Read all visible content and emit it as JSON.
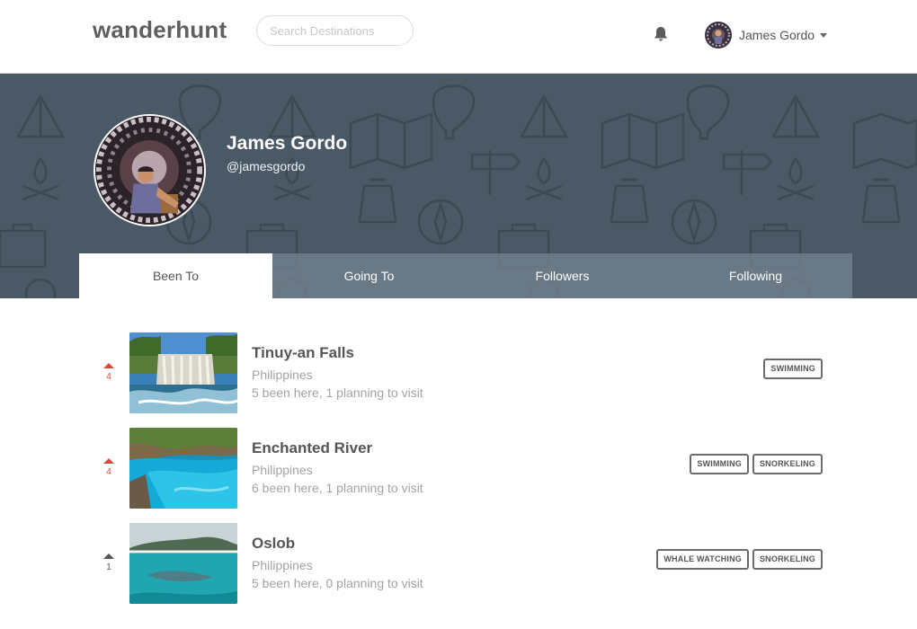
{
  "app": {
    "logo": "wanderhunt"
  },
  "search": {
    "placeholder": "Search Destinations",
    "value": ""
  },
  "header": {
    "notifications_icon": "bell-icon",
    "user_name": "James Gordo"
  },
  "profile": {
    "name": "James Gordo",
    "handle": "@jamesgordo"
  },
  "tabs": [
    {
      "label": "Been To",
      "active": true
    },
    {
      "label": "Going To",
      "active": false
    },
    {
      "label": "Followers",
      "active": false
    },
    {
      "label": "Following",
      "active": false
    }
  ],
  "destinations": [
    {
      "title": "Tinuy-an Falls",
      "country": "Philippines",
      "stats": "5 been here, 1 planning to visit",
      "votes": "4",
      "voted": true,
      "tags": [
        "SWIMMING"
      ]
    },
    {
      "title": "Enchanted River",
      "country": "Philippines",
      "stats": "6 been here, 1 planning to visit",
      "votes": "4",
      "voted": true,
      "tags": [
        "SWIMMING",
        "SNORKELING"
      ]
    },
    {
      "title": "Oslob",
      "country": "Philippines",
      "stats": "5 been here, 0 planning to visit",
      "votes": "1",
      "voted": false,
      "tags": [
        "WHALE WATCHING",
        "SNORKELING"
      ]
    }
  ],
  "colors": {
    "header_bg": "#4a5965",
    "tab_bar": "#70808c",
    "upvote_active": "#e0463d",
    "upvote_inactive": "#555555",
    "muted_text": "#a3a3a3"
  }
}
